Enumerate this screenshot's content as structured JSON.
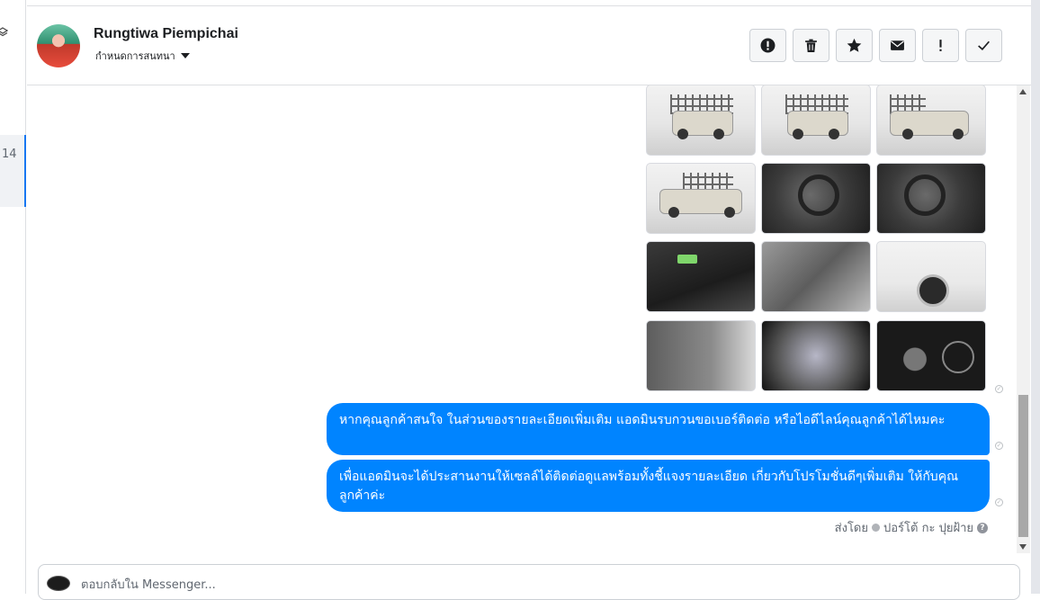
{
  "sidebar": {
    "selected_item_text": "14"
  },
  "header": {
    "name": "Rungtiwa Piempichai",
    "assign_label": "กำหนดการสนทนา",
    "actions": [
      "alert-icon",
      "trash-icon",
      "star-icon",
      "envelope-icon",
      "exclamation-icon",
      "checkmark-icon"
    ]
  },
  "conversation": {
    "thumbnails": [
      "truck-rear-rack",
      "truck-rear-rack-2",
      "truck-side-rack",
      "truck-side-rack-2",
      "steering-wheel",
      "steering-wheel-2",
      "dashboard-console",
      "cabin-seats",
      "front-wheel",
      "door-interior",
      "engine-bay",
      "gauge-cluster"
    ],
    "messages": [
      {
        "text": "หากคุณลูกค้าสนใจ ในส่วนของรายละเอียดเพิ่มเติม แอดมินรบกวนขอเบอร์ติดต่อ หรือไอดีไลน์คุณลูกค้าได้ไหมคะ"
      },
      {
        "text": "เพื่อแอดมินจะได้ประสานงานให้เซลล์ได้ติดต่อดูแลพร้อมทั้งชี้แจงรายละเอียด เกี่ยวกับโปรโมชั่นดีๆเพิ่มเติม ให้กับคุณลูกค้าค่ะ"
      }
    ],
    "sent_by_label": "ส่งโดย",
    "sender_name": "ปอร์โต้ กะ ปุยฝ้าย"
  },
  "reply": {
    "placeholder": "ตอบกลับใน Messenger..."
  },
  "colors": {
    "bubble": "#0084ff",
    "accent": "#1877f2"
  }
}
